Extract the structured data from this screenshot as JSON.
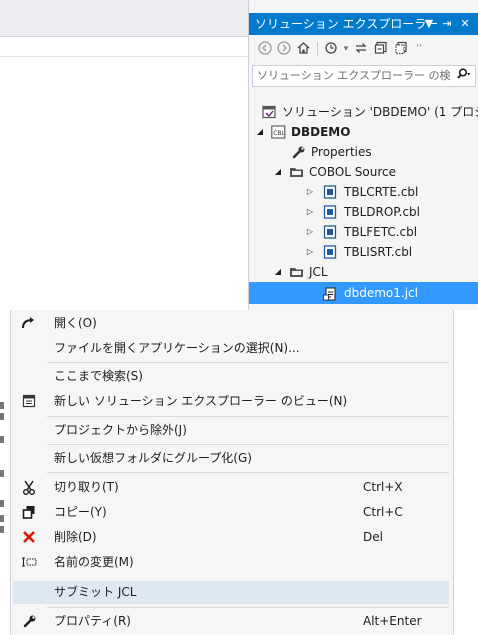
{
  "solution_explorer": {
    "title": "ソリューション エクスプローラー",
    "title_buttons": [
      "▼",
      "⇥",
      "✕"
    ],
    "search_placeholder": "ソリューション エクスプローラー の検",
    "tree": [
      {
        "label": "ソリューション 'DBDEMO' (1 プロジ",
        "icon": "solution-icon",
        "arrow": ""
      },
      {
        "label": "DBDEMO",
        "icon": "cobol-project-icon",
        "arrow": "expanded"
      },
      {
        "label": "Properties",
        "icon": "wrench-icon",
        "arrow": ""
      },
      {
        "label": "COBOL Source",
        "icon": "folder-icon",
        "arrow": "expanded"
      },
      {
        "label": "TBLCRTE.cbl",
        "icon": "cobol-file-icon",
        "arrow": "collapsed"
      },
      {
        "label": "TBLDROP.cbl",
        "icon": "cobol-file-icon",
        "arrow": "collapsed"
      },
      {
        "label": "TBLFETC.cbl",
        "icon": "cobol-file-icon",
        "arrow": "collapsed"
      },
      {
        "label": "TBLISRT.cbl",
        "icon": "cobol-file-icon",
        "arrow": "collapsed"
      },
      {
        "label": "JCL",
        "icon": "folder-icon",
        "arrow": "expanded"
      },
      {
        "label": "dbdemo1.jcl",
        "icon": "jcl-file-icon",
        "arrow": "",
        "selected": true
      }
    ]
  },
  "context_menu": {
    "items": [
      {
        "label": "開く(O)",
        "icon": "open-icon",
        "shortcut": ""
      },
      {
        "label": "ファイルを開くアプリケーションの選択(N)...",
        "icon": "",
        "shortcut": ""
      },
      {
        "label": "ここまで検索(S)",
        "icon": "",
        "shortcut": ""
      },
      {
        "label": "新しい ソリューション エクスプローラー のビュー(N)",
        "icon": "new-view-icon",
        "shortcut": ""
      },
      {
        "label": "プロジェクトから除外(J)",
        "icon": "",
        "shortcut": ""
      },
      {
        "label": "新しい仮想フォルダにグループ化(G)",
        "icon": "",
        "shortcut": ""
      },
      {
        "label": "切り取り(T)",
        "icon": "cut-icon",
        "shortcut": "Ctrl+X"
      },
      {
        "label": "コピー(Y)",
        "icon": "copy-icon",
        "shortcut": "Ctrl+C"
      },
      {
        "label": "削除(D)",
        "icon": "delete-icon",
        "shortcut": "Del"
      },
      {
        "label": "名前の変更(M)",
        "icon": "rename-icon",
        "shortcut": ""
      },
      {
        "label": "サブミット JCL",
        "icon": "",
        "shortcut": "",
        "hover": true
      },
      {
        "label": "プロパティ(R)",
        "icon": "wrench-icon",
        "shortcut": "Alt+Enter"
      }
    ]
  },
  "colors": {
    "title_bar": "#007acc",
    "selection": "#3399ff",
    "menu_hover": "#dde8f3",
    "delete_icon": "#e51400"
  }
}
